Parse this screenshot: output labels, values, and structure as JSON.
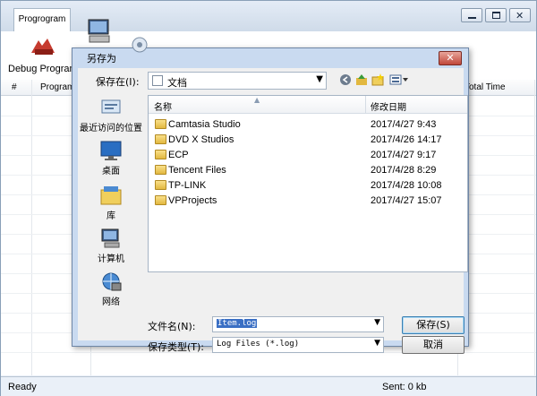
{
  "app": {
    "tab_label": "Progrogram",
    "debug_label": "Debug Program",
    "columns": [
      "#",
      "Program",
      "Total Time"
    ],
    "status": "Ready",
    "sent": "Sent: 0 kb"
  },
  "dialog": {
    "title": "另存为",
    "save_in_label": "保存在(I):",
    "save_in_value": "文档",
    "places": [
      {
        "label": "最近访问的位置",
        "icon": "recent-places-icon"
      },
      {
        "label": "桌面",
        "icon": "desktop-icon"
      },
      {
        "label": "库",
        "icon": "library-icon"
      },
      {
        "label": "计算机",
        "icon": "computer-icon"
      },
      {
        "label": "网络",
        "icon": "network-icon"
      }
    ],
    "list_header": {
      "name": "名称",
      "date": "修改日期"
    },
    "files": [
      {
        "name": "Camtasia Studio",
        "date": "2017/4/27 9:43"
      },
      {
        "name": "DVD X Studios",
        "date": "2017/4/26 14:17"
      },
      {
        "name": "ECP",
        "date": "2017/4/27 9:17"
      },
      {
        "name": "Tencent Files",
        "date": "2017/4/28 8:29"
      },
      {
        "name": "TP-LINK",
        "date": "2017/4/28 10:08"
      },
      {
        "name": "VPProjects",
        "date": "2017/4/27 15:07"
      }
    ],
    "filename_label": "文件名(N):",
    "filename_value": "Item.log",
    "filetype_label": "保存类型(T):",
    "filetype_value": "Log Files (*.log)",
    "save_button": "保存(S)",
    "cancel_button": "取消"
  }
}
